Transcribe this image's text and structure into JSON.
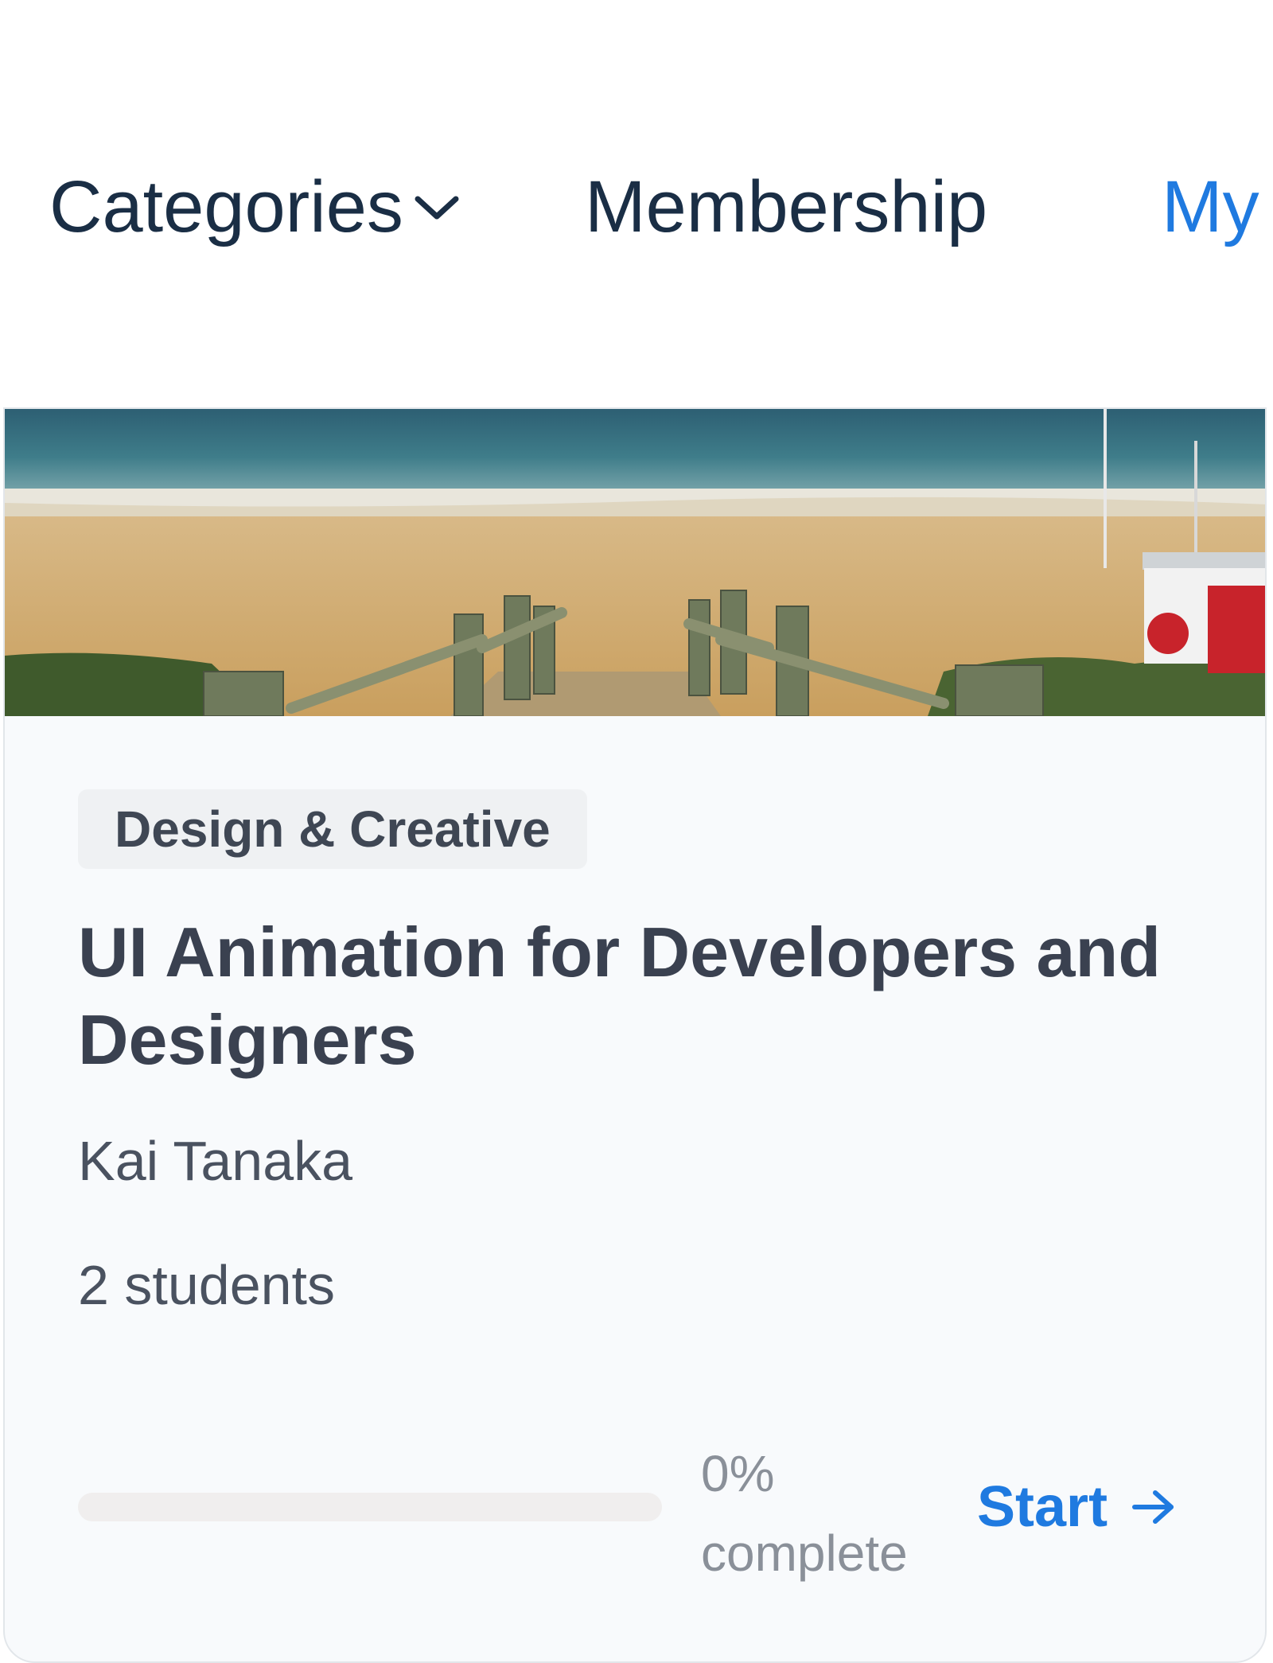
{
  "nav": {
    "items": [
      {
        "label": "Categories",
        "icon": "chevron-down-icon"
      },
      {
        "label": "Membership"
      },
      {
        "label": "My"
      }
    ],
    "active_color": "#1f7ae0"
  },
  "course": {
    "image": "beach-boardwalk-photo",
    "category": "Design & Creative",
    "title": "UI Animation for Developers and Designers",
    "instructor": "Kai Tanaka",
    "students": "2 students",
    "progress": {
      "value": 0,
      "label_line1": "0%",
      "label_line2": "complete"
    },
    "cta": {
      "label": "Start",
      "icon": "arrow-right-icon"
    }
  }
}
